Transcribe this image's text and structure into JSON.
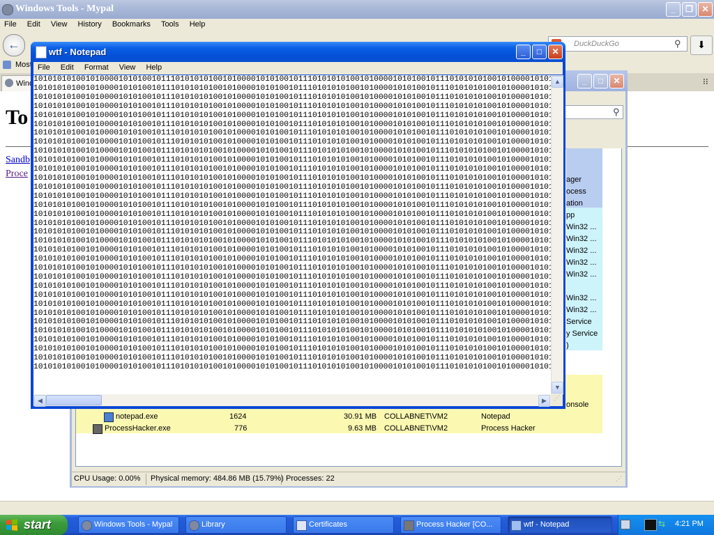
{
  "firefox": {
    "title": "Windows Tools - Mypal",
    "menu": [
      "File",
      "Edit",
      "View",
      "History",
      "Bookmarks",
      "Tools",
      "Help"
    ],
    "search_placeholder": "DuckDuckGo",
    "bookmark_fragment": "Most",
    "tab_fragment": "Wind",
    "page_heading_fragment": "To",
    "links": [
      "Sandb",
      "Proce"
    ]
  },
  "process_hacker": {
    "descriptions": [
      "ager",
      "ocess",
      "ation",
      "pp",
      "Win32 ...",
      "Win32 ...",
      "Win32 ...",
      "Win32 ...",
      "Win32 ...",
      "Win32 ...",
      "Win32 ...",
      "Service",
      "y Service",
      ")",
      "onsole"
    ],
    "rows": [
      {
        "name": "notepad.exe",
        "pid": "1624",
        "memory": "30.91 MB",
        "user": "COLLABNET\\VM2",
        "description": "Notepad"
      },
      {
        "name": "ProcessHacker.exe",
        "pid": "776",
        "memory": "9.63 MB",
        "user": "COLLABNET\\VM2",
        "description": "Process Hacker"
      }
    ],
    "status": {
      "cpu": "CPU Usage: 0.00%",
      "memory": "Physical memory: 484.86 MB (15.79%)",
      "processes": "Processes: 22"
    }
  },
  "notepad": {
    "title": "wtf - Notepad",
    "menu": [
      "File",
      "Edit",
      "Format",
      "View",
      "Help"
    ],
    "text_line": "101010101001010000101010010111010101010010100001010100101110101010100101000010101001011101010101001010000101010010111010",
    "line_count": 33
  },
  "taskbar": {
    "start_label": "start",
    "tasks": [
      {
        "label": "Windows Tools - Mypal",
        "active": false
      },
      {
        "label": "Library",
        "active": false
      },
      {
        "label": "Certificates",
        "active": false
      },
      {
        "label": "Process Hacker [CO...",
        "active": false
      },
      {
        "label": "wtf - Notepad",
        "active": true
      }
    ],
    "clock": "4:21 PM"
  }
}
